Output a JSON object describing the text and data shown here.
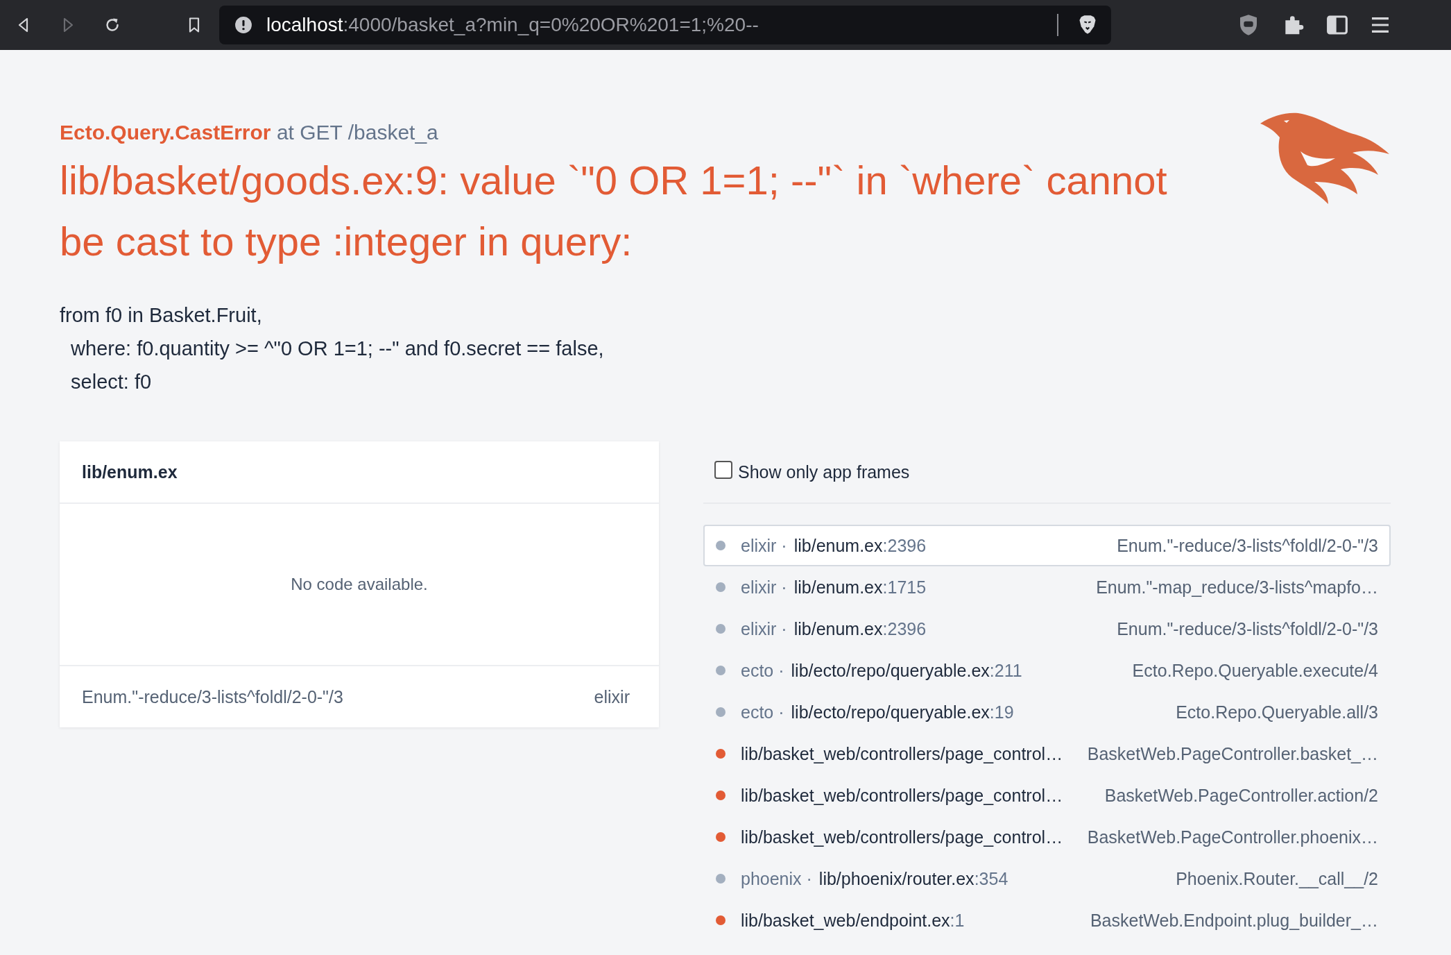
{
  "browser": {
    "url_host": "localhost",
    "url_rest": ":4000/basket_a?min_q=0%20OR%201=1;%20--",
    "forward_disabled": true
  },
  "error": {
    "exception": "Ecto.Query.CastError",
    "route": "at GET /basket_a",
    "message": "lib/basket/goods.ex:9: value `\"0 OR 1=1; --\"` in `where` cannot be cast to type :integer in query:",
    "query_lines": [
      "from f0 in Basket.Fruit,",
      "  where: f0.quantity >= ^\"0 OR 1=1; --\" and f0.secret == false,",
      "  select: f0"
    ]
  },
  "code_panel": {
    "file": "lib/enum.ex",
    "body": "No code available.",
    "function": "Enum.\"-reduce/3-lists^foldl/2-0-\"/3",
    "app": "elixir"
  },
  "frames_filter": {
    "label": "Show only app frames",
    "checked": false
  },
  "frames": [
    {
      "app_frame": false,
      "selected": true,
      "app": "elixir ·",
      "file": "lib/enum.ex",
      "line": ":2396",
      "function": "Enum.\"-reduce/3-lists^foldl/2-0-\"/3"
    },
    {
      "app_frame": false,
      "selected": false,
      "app": "elixir ·",
      "file": "lib/enum.ex",
      "line": ":1715",
      "function": "Enum.\"-map_reduce/3-lists^mapfo…"
    },
    {
      "app_frame": false,
      "selected": false,
      "app": "elixir ·",
      "file": "lib/enum.ex",
      "line": ":2396",
      "function": "Enum.\"-reduce/3-lists^foldl/2-0-\"/3"
    },
    {
      "app_frame": false,
      "selected": false,
      "app": "ecto ·",
      "file": "lib/ecto/repo/queryable.ex",
      "line": ":211",
      "function": "Ecto.Repo.Queryable.execute/4"
    },
    {
      "app_frame": false,
      "selected": false,
      "app": "ecto ·",
      "file": "lib/ecto/repo/queryable.ex",
      "line": ":19",
      "function": "Ecto.Repo.Queryable.all/3"
    },
    {
      "app_frame": true,
      "selected": false,
      "file": "lib/basket_web/controllers/page_control…",
      "function": "BasketWeb.PageController.basket_…"
    },
    {
      "app_frame": true,
      "selected": false,
      "file": "lib/basket_web/controllers/page_control…",
      "function": "BasketWeb.PageController.action/2"
    },
    {
      "app_frame": true,
      "selected": false,
      "file": "lib/basket_web/controllers/page_control…",
      "function": "BasketWeb.PageController.phoenix…"
    },
    {
      "app_frame": false,
      "selected": false,
      "app": "phoenix ·",
      "file": "lib/phoenix/router.ex",
      "line": ":354",
      "function": "Phoenix.Router.__call__/2"
    },
    {
      "app_frame": true,
      "selected": false,
      "file": "lib/basket_web/endpoint.ex",
      "line": ":1",
      "function": "BasketWeb.Endpoint.plug_builder_…"
    }
  ]
}
